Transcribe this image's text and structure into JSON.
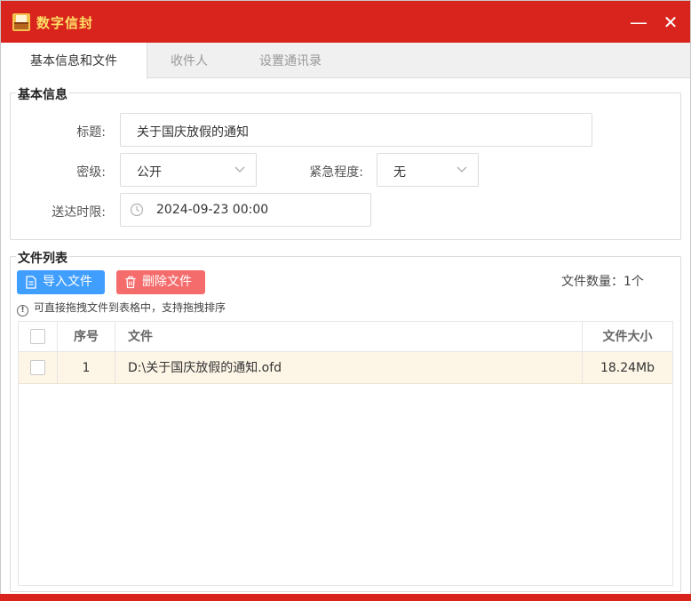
{
  "app": {
    "title": "数字信封",
    "title_color": "#ffe066",
    "titlebar_color": "#d9241d",
    "min_symbol": "—",
    "close_symbol": "✕"
  },
  "tabs": [
    {
      "label": "基本信息和文件",
      "active": true
    },
    {
      "label": "收件人",
      "active": false
    },
    {
      "label": "设置通讯录",
      "active": false
    }
  ],
  "basic_info": {
    "group_title": "基本信息",
    "subject_label": "标题:",
    "subject_value": "关于国庆放假的通知",
    "secret_label": "密级:",
    "secret_value": "公开",
    "urgency_label": "紧急程度:",
    "urgency_value": "无",
    "deadline_label": "送达时限:",
    "deadline_value": "2024-09-23 00:00"
  },
  "file_list": {
    "group_title": "文件列表",
    "import_button": "导入文件",
    "delete_button": "删除文件",
    "count_text": "文件数量：1个",
    "hint_text": "可直接拖拽文件到表格中，支持拖拽排序",
    "columns": [
      "序号",
      "文件",
      "文件大小"
    ],
    "rows": [
      {
        "no": "1",
        "file": "D:\\关于国庆放假的通知.ofd",
        "size": "18.24Mb"
      }
    ],
    "import_color": "#409eff",
    "delete_color": "#f56c6c",
    "selected_row_color": "#fdf5e6"
  }
}
